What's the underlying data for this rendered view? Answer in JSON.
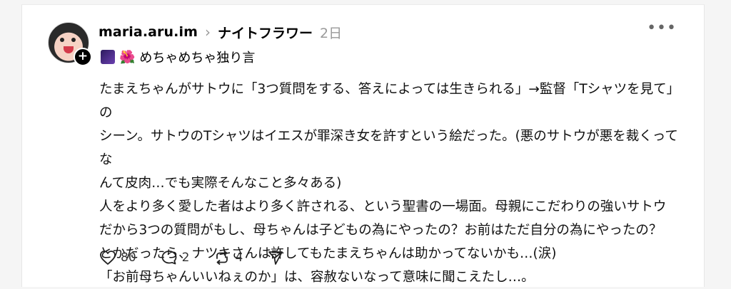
{
  "post": {
    "username": "maria.aru.im",
    "community": "ナイトフラワー",
    "time": "2日",
    "tag_text": "めちゃめちゃ独り言",
    "body_lines": [
      "たまえちゃんがサトウに「3つ質問をする、答えによっては生きられる」→監督「Tシャツを見て」の",
      "シーン。サトウのTシャツはイエスが罪深き女を許すという絵だった。(悪のサトウが悪を裁くってな",
      "んて皮肉…でも実際そんなこと多々ある)",
      "人をより多く愛した者はより多く許される、という聖書の一場面。母親にこだわりの強いサトウ",
      "だから3つの質問がもし、母ちゃんは子どもの為にやったの？お前はただ自分の為にやったの？",
      "とかだったら、ナツキさんは許してもたまえちゃんは助かってないかも…(涙)",
      "「お前母ちゃんいいねぇのか」は、容赦ないなって意味に聞こえたし…。"
    ],
    "likes": "80",
    "comments": "2",
    "reposts": "4"
  },
  "icons": {
    "more": "more-icon",
    "like": "heart-icon",
    "comment": "comment-icon",
    "repost": "repost-icon",
    "share": "send-icon",
    "follow": "plus-icon"
  }
}
